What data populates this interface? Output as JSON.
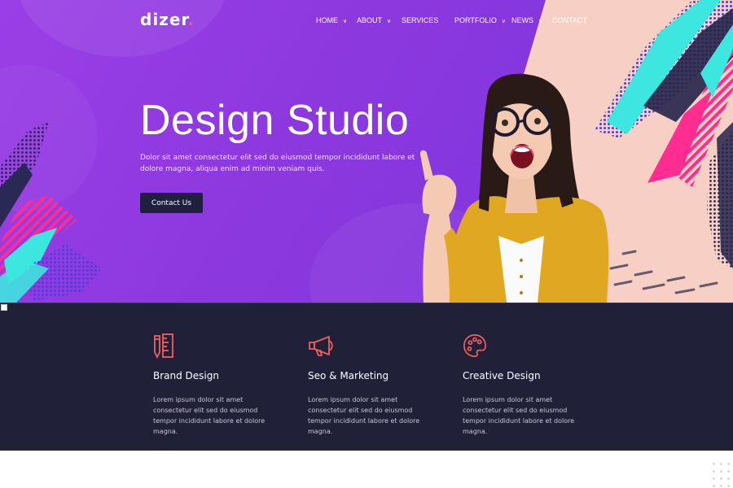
{
  "brand": {
    "logo_text": "dizer",
    "logo_dot": ".",
    "accent": "#ff4f8b"
  },
  "nav": {
    "items": [
      {
        "label": "HOME",
        "has_dropdown": true
      },
      {
        "label": "ABOUT",
        "has_dropdown": true
      },
      {
        "label": "SERVICES",
        "has_dropdown": false
      },
      {
        "label": "PORTFOLIO",
        "has_dropdown": true
      },
      {
        "label": "NEWS",
        "has_dropdown": true
      },
      {
        "label": "CONTACT",
        "has_dropdown": false
      }
    ]
  },
  "hero": {
    "title": "Design Studio",
    "description": "Dolor sit amet consectetur elit sed do eiusmod tempor incididunt labore et dolore magna, aliqua enim ad minim veniam quis.",
    "cta_label": "Contact Us"
  },
  "services": [
    {
      "icon": "ruler-pencil-icon",
      "title": "Brand Design",
      "description": "Lorem ipsum dolor sit amet consectetur elit sed do eiusmod tempor incididunt labore et dolore magna."
    },
    {
      "icon": "megaphone-icon",
      "title": "Seo & Marketing",
      "description": "Lorem ipsum dolor sit amet consectetur elit sed do eiusmod tempor incididunt labore et dolore magna."
    },
    {
      "icon": "palette-icon",
      "title": "Creative Design",
      "description": "Lorem ipsum dolor sit amet consectetur elit sed do eiusmod tempor incididunt labore et dolore magna."
    }
  ],
  "colors": {
    "hero_purple": "#8d38df",
    "peach": "#f7cfc4",
    "dark_navy": "#212039",
    "icon_coral": "#f0605f",
    "cyan": "#3ee6e0",
    "pink": "#ff2d8f"
  }
}
